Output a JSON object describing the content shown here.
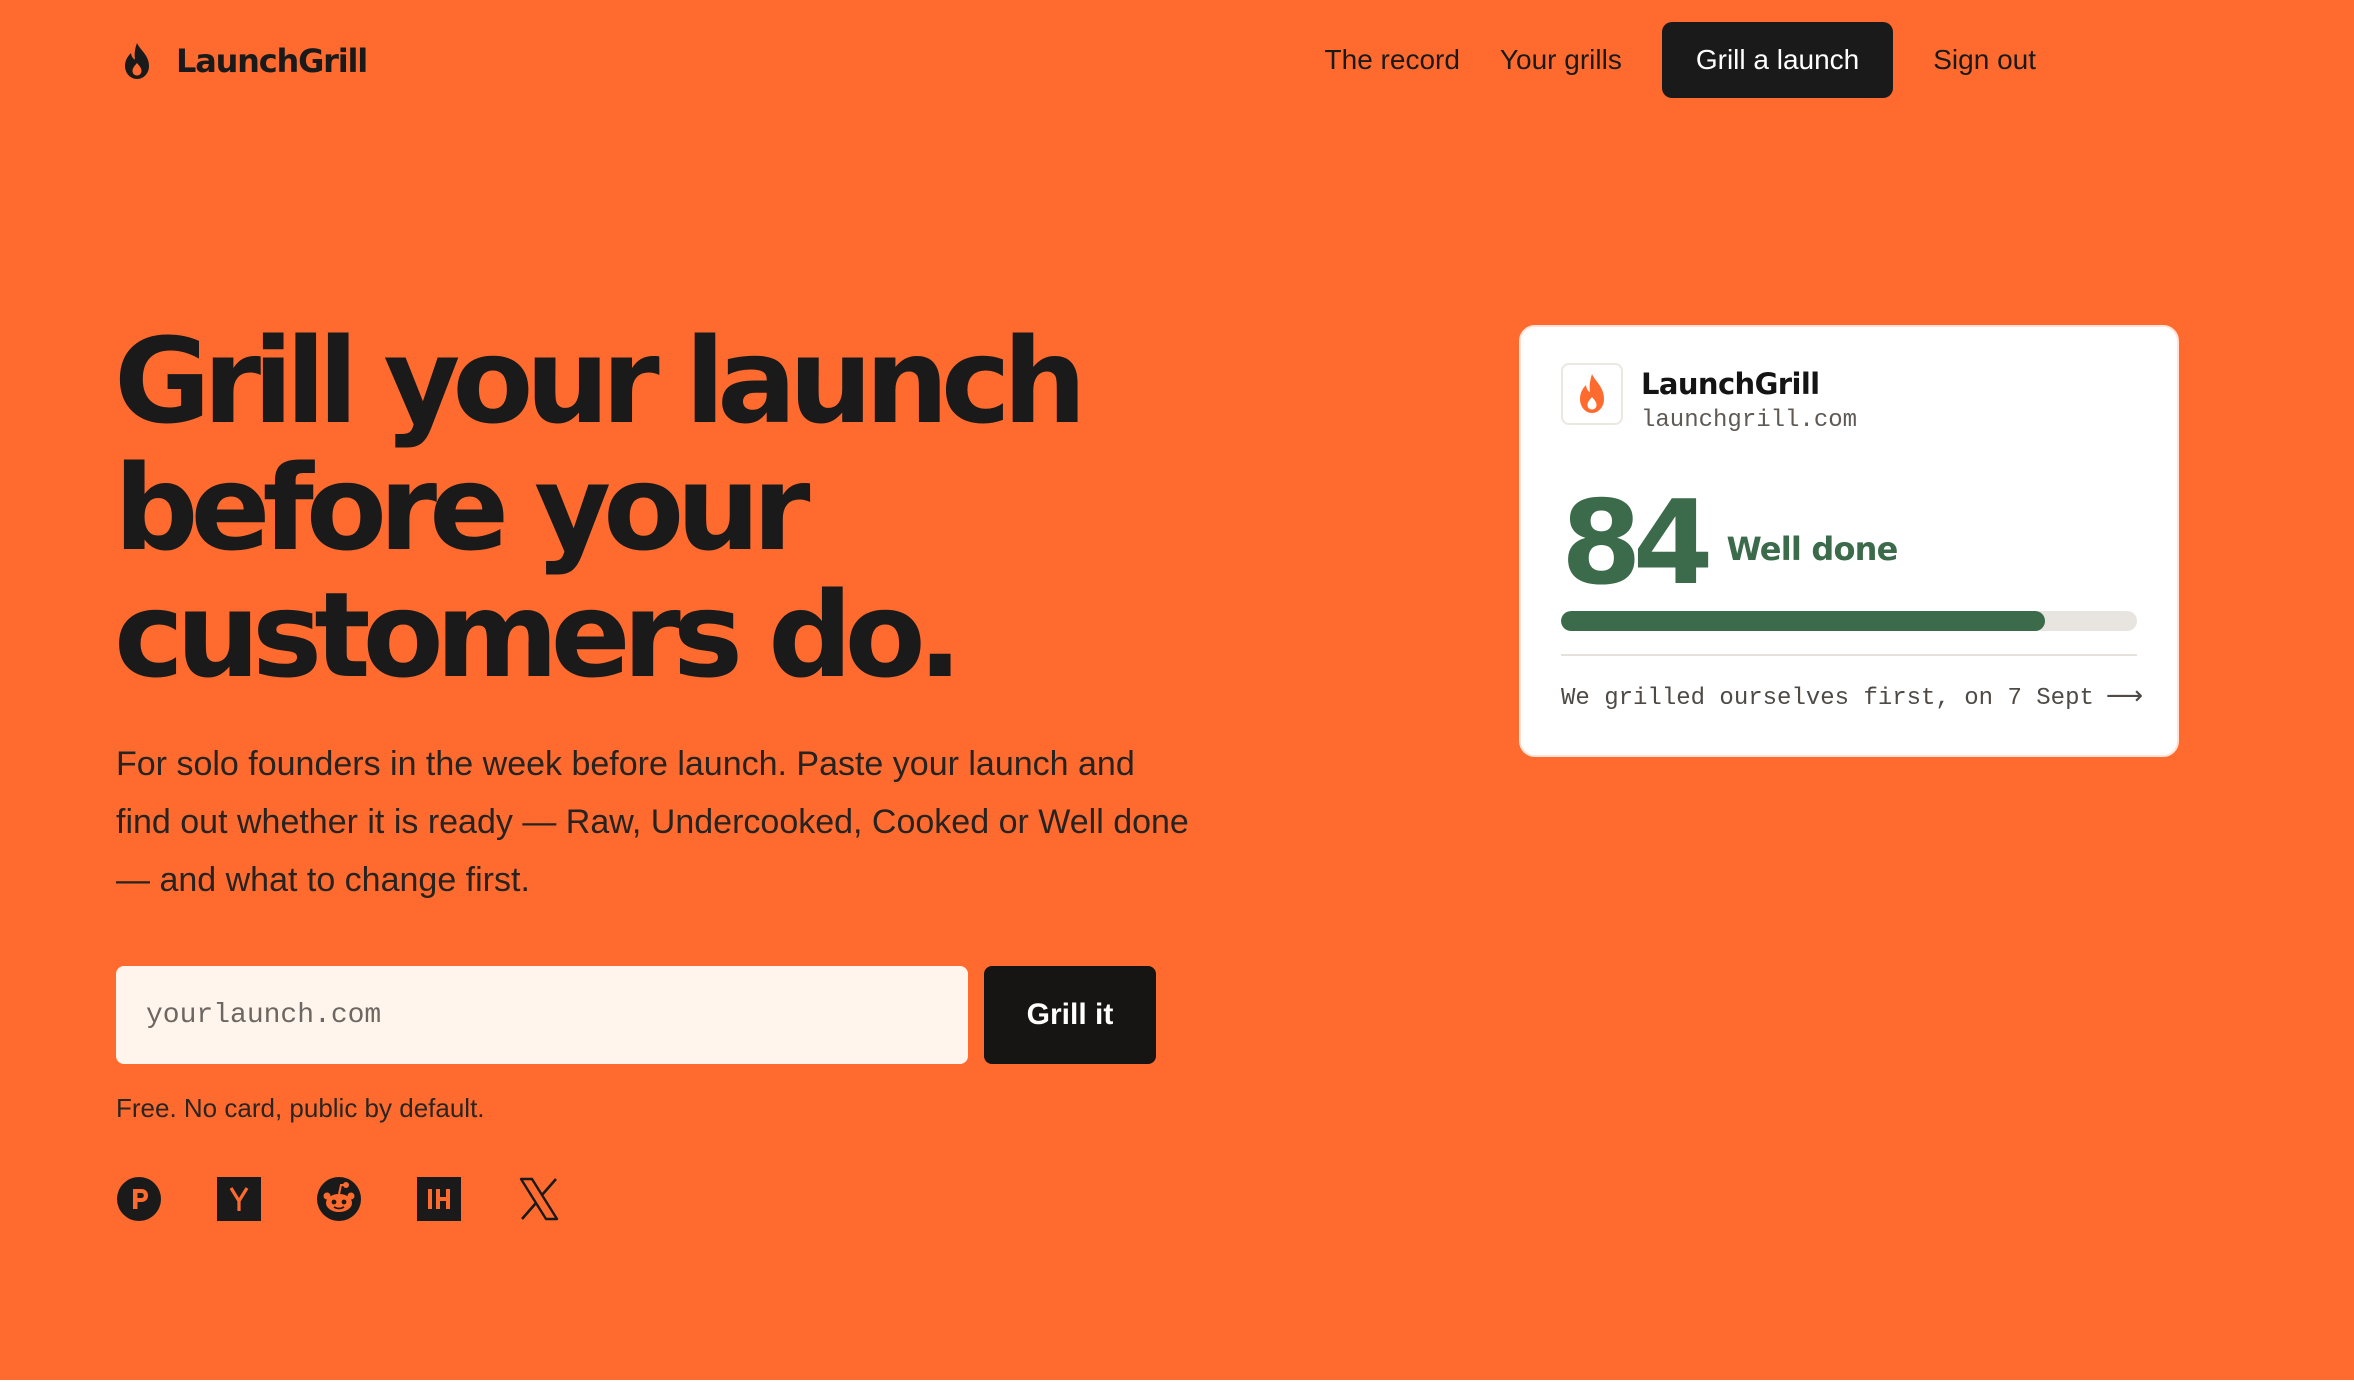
{
  "header": {
    "brand": "LaunchGrill",
    "nav": {
      "record": "The record",
      "grills": "Your grills",
      "cta": "Grill a launch",
      "sign_out": "Sign out"
    }
  },
  "hero": {
    "headline_lines": [
      "Grill your launch",
      "before your",
      "customers do."
    ],
    "subhead": "For solo founders in the week before launch. Paste your launch and find out whether it is ready — Raw, Undercooked, Cooked or Well done — and what to change first.",
    "input_placeholder": "yourlaunch.com",
    "submit_label": "Grill it",
    "note": "Free. No card, public by default.",
    "platforms": [
      "product-hunt-icon",
      "hacker-news-icon",
      "reddit-icon",
      "indie-hackers-icon",
      "x-icon"
    ]
  },
  "score_card": {
    "name": "LaunchGrill",
    "domain": "launchgrill.com",
    "score": "84",
    "verdict": "Well done",
    "progress_fraction": 0.84,
    "footer": "We grilled ourselves first, on 7 Sept",
    "footer_arrow": "⟶"
  },
  "colors": {
    "background": "#ff6b2f",
    "ink": "#1a1a1a",
    "score_green": "#3b6b4a",
    "input_background": "#fff5ec",
    "card_background": "#ffffff"
  }
}
